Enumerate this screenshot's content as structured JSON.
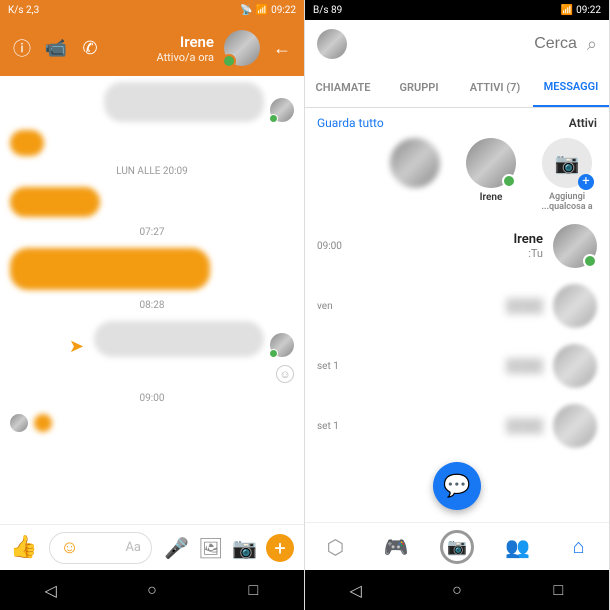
{
  "left": {
    "statusbar": {
      "speed": "2,3 K/s",
      "time": "09:22"
    },
    "header": {
      "name": "Irene",
      "status": "Attivo/a ora"
    },
    "timestamps": {
      "t1": "LUN ALLE 20:09",
      "t2": "07:27",
      "t3": "08:28",
      "t4": "09:00"
    },
    "input": {
      "placeholder": "Aa"
    }
  },
  "right": {
    "statusbar": {
      "speed": "89 B/s",
      "time": "09:22"
    },
    "search": {
      "placeholder": "Cerca"
    },
    "tabs": {
      "messages": "MESSAGGI",
      "active": "ATTIVI (7)",
      "groups": "GRUPPI",
      "calls": "CHIAMATE"
    },
    "actives": {
      "title": "Attivi",
      "viewall": "Guarda tutto",
      "add": "Aggiungi qualcosa a...",
      "irene": "Irene"
    },
    "convs": {
      "c1": {
        "name": "Irene",
        "sub": "Tu:",
        "time": "09:00"
      },
      "c2": {
        "time": "ven"
      },
      "c3": {
        "time": "1 set"
      },
      "c4": {
        "time": "1 set"
      }
    }
  }
}
